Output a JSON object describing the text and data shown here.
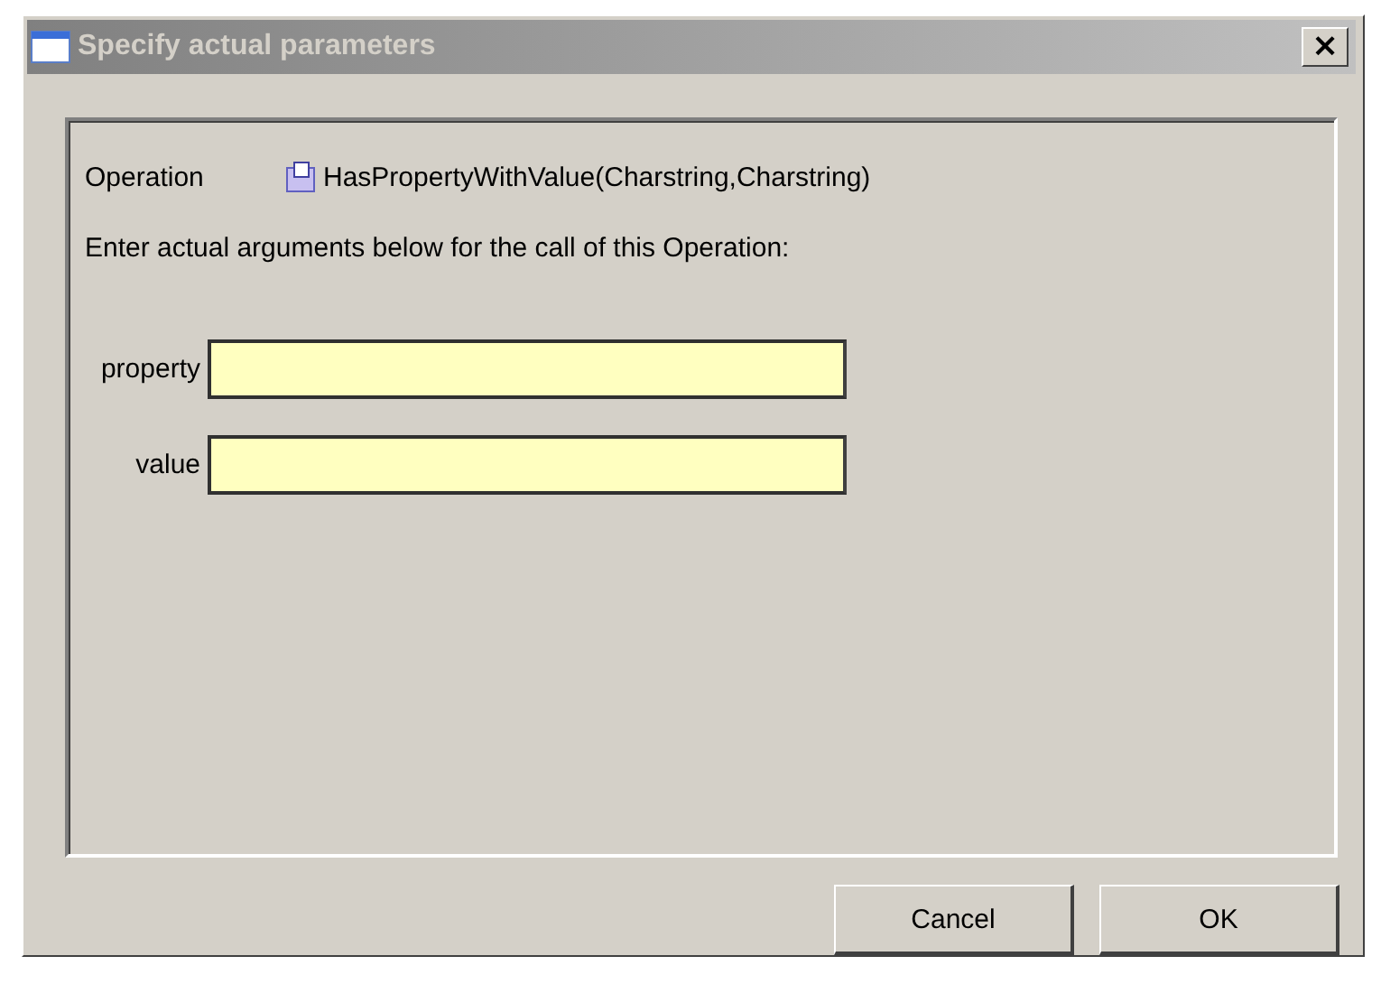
{
  "window": {
    "title": "Specify actual parameters",
    "close": "×"
  },
  "operation": {
    "label": "Operation",
    "signature": "HasPropertyWithValue(Charstring,Charstring)"
  },
  "instruction": "Enter actual arguments below for the call of this Operation:",
  "arguments": [
    {
      "label": "property"
    },
    {
      "label": "value"
    }
  ],
  "buttons": [
    "Cancel",
    "OK"
  ]
}
